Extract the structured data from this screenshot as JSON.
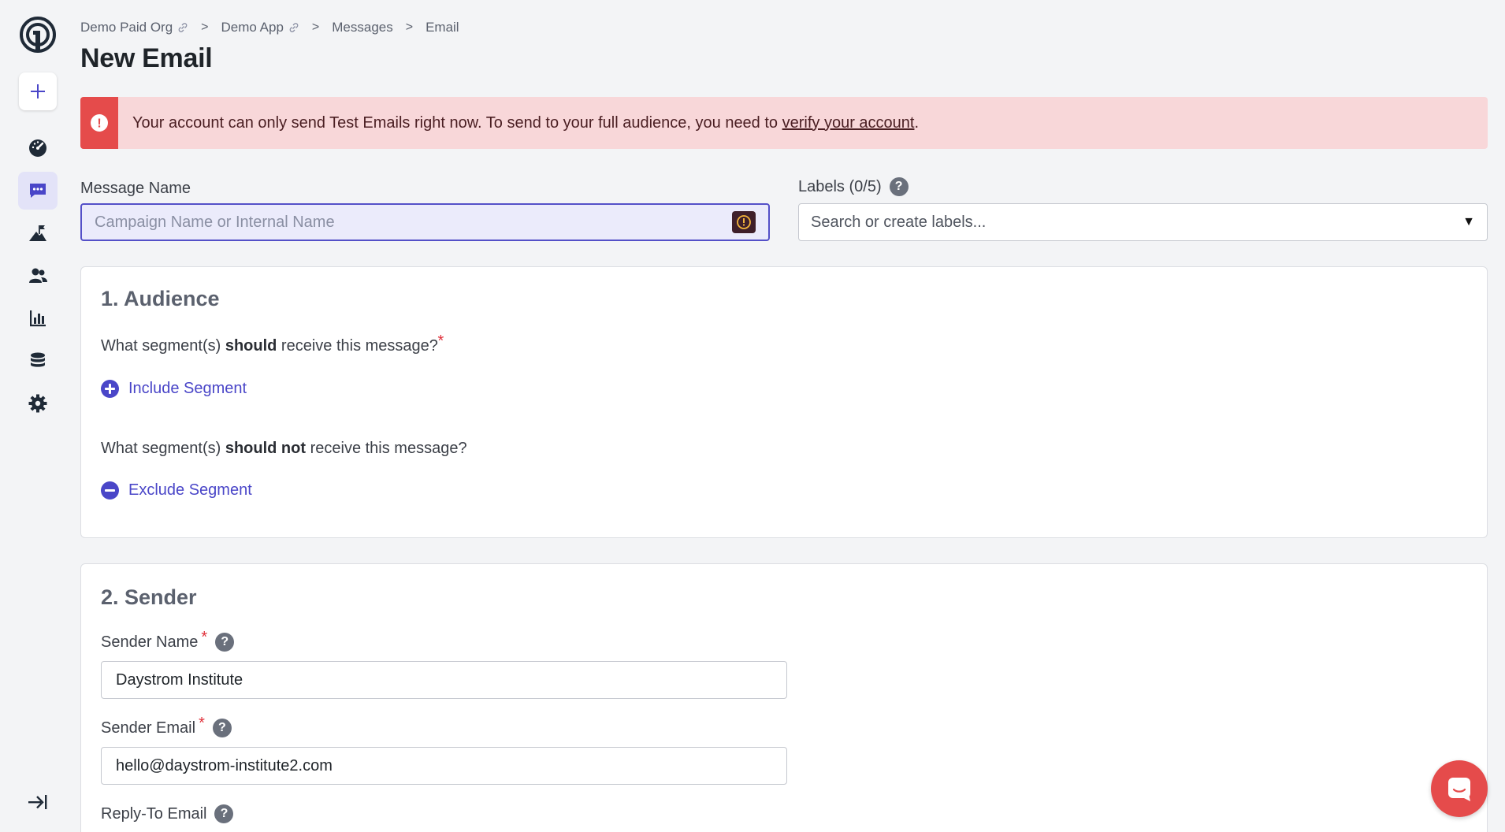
{
  "breadcrumb": {
    "items": [
      "Demo Paid Org",
      "Demo App",
      "Messages",
      "Email"
    ],
    "separator": ">"
  },
  "page": {
    "title": "New Email"
  },
  "alert": {
    "text_before": "Your account can only send Test Emails right now. To send to your full audience, you need to ",
    "link_text": "verify your account",
    "text_after": ".",
    "icon_symbol": "!",
    "color": "#e54b4b"
  },
  "message_name": {
    "label": "Message Name",
    "placeholder": "Campaign Name or Internal Name",
    "value": ""
  },
  "labels": {
    "label": "Labels (0/5)",
    "placeholder": "Search or create labels...",
    "caret": "▼"
  },
  "audience": {
    "title": "1. Audience",
    "include_question_pre": "What segment(s) ",
    "include_question_bold": "should",
    "include_question_post": " receive this message?",
    "include_button": "Include Segment",
    "exclude_question_pre": "What segment(s) ",
    "exclude_question_bold": "should not",
    "exclude_question_post": " receive this message?",
    "exclude_button": "Exclude Segment"
  },
  "sender": {
    "title": "2. Sender",
    "name_label": "Sender Name",
    "name_value": "Daystrom Institute",
    "email_label": "Sender Email",
    "email_value": "hello@daystrom-institute2.com",
    "reply_to_label": "Reply-To Email"
  },
  "common": {
    "required_marker": "*",
    "help_symbol": "?"
  },
  "colors": {
    "accent": "#4a46c8",
    "danger": "#e54b4b",
    "nav_active_bg": "#e3e3f8"
  },
  "sidebar": {
    "items": [
      "dashboard-icon",
      "messages-icon",
      "journeys-icon",
      "audience-icon",
      "analytics-icon",
      "data-icon",
      "settings-icon"
    ],
    "active": "messages-icon"
  }
}
